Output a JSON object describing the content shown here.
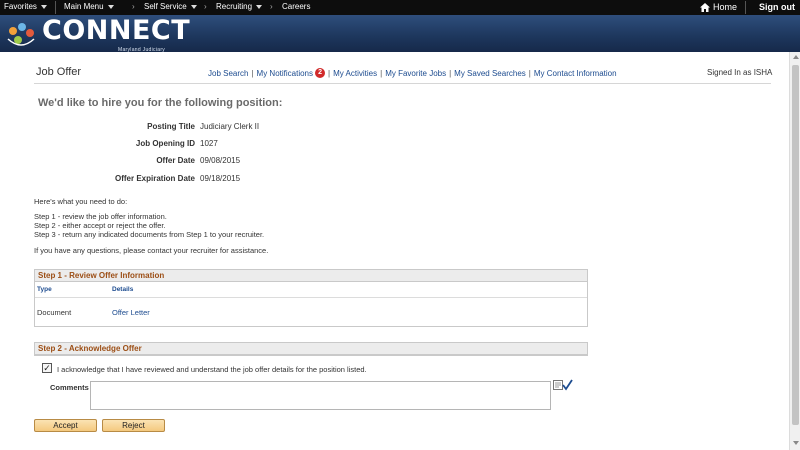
{
  "topnav": {
    "favorites": "Favorites",
    "main_menu": "Main Menu",
    "self_service": "Self Service",
    "recruiting": "Recruiting",
    "careers": "Careers",
    "home": "Home",
    "sign_out": "Sign out"
  },
  "brand": {
    "name": "CONNECT",
    "sub": "Maryland Judiciary"
  },
  "header": {
    "title": "Job Offer",
    "links": {
      "job_search": "Job Search",
      "my_notifications": "My Notifications",
      "notifications_count": "2",
      "my_activities": "My Activities",
      "my_favorite_jobs": "My Favorite Jobs",
      "my_saved_searches": "My Saved Searches",
      "my_contact_information": "My Contact Information"
    },
    "signed_in": "Signed In as ISHA"
  },
  "offer": {
    "heading": "We'd like to hire you for the following position:",
    "fields": [
      {
        "label": "Posting Title",
        "value": "Judiciary Clerk II"
      },
      {
        "label": "Job Opening ID",
        "value": "1027"
      },
      {
        "label": "Offer Date",
        "value": "09/08/2015"
      },
      {
        "label": "Offer Expiration Date",
        "value": "09/18/2015"
      }
    ]
  },
  "instructions": {
    "intro": "Here's what you need to do:",
    "step1": "Step 1 - review the job offer information.",
    "step2": "Step 2 - either accept or reject the offer.",
    "step3": "Step 3 - return any indicated documents from Step 1 to your recruiter.",
    "questions": "If you have any questions, please contact your recruiter for assistance."
  },
  "step1_section": {
    "title": "Step 1 - Review Offer Information",
    "columns": {
      "type": "Type",
      "details": "Details"
    },
    "row": {
      "type": "Document",
      "details": "Offer Letter"
    }
  },
  "step2_section": {
    "title": "Step 2 - Acknowledge Offer",
    "checkbox_mark": "✓",
    "ack_text": "I acknowledge that I have reviewed and understand the job offer details for the position listed.",
    "comments_label": "Comments",
    "comments_value": ""
  },
  "buttons": {
    "accept": "Accept",
    "reject": "Reject"
  },
  "colors": {
    "nav_bg": "#0d0d0d",
    "banner": "#1d365c",
    "link": "#1c4b8f",
    "section_title": "#9c4e15",
    "badge": "#d12a2a",
    "button": "#f4c97f"
  }
}
